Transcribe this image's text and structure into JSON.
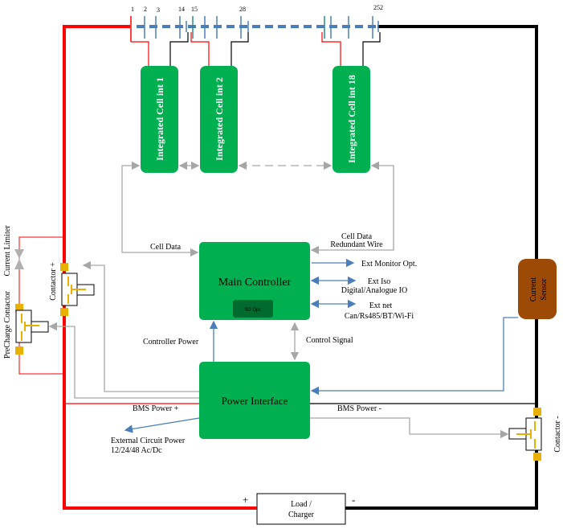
{
  "cells": {
    "numbers": [
      "1",
      "2",
      "3",
      "14",
      "15",
      "28",
      "252"
    ]
  },
  "modules": [
    {
      "label": "Integrated Cell int 1"
    },
    {
      "label": "Integrated Cell int 2"
    },
    {
      "label": "Integrated Cell int 18"
    }
  ],
  "main_controller": {
    "label": "Main Controller",
    "sd": "SD Opt."
  },
  "power_interface": {
    "label": "Power Interface"
  },
  "current_sensor": {
    "line1": "Current",
    "line2": "Sensor"
  },
  "labels": {
    "cell_data": "Cell Data",
    "cell_data_redundant_1": "Cell Data",
    "cell_data_redundant_2": "Redundant Wire",
    "ext_monitor": "Ext Monitor Opt.",
    "ext_iso_1": "Ext Iso",
    "ext_iso_2": "Digital/Analogue IO",
    "ext_net_1": "Ext net",
    "ext_net_2": "Can/Rs485/BT/Wi-Fi",
    "controller_power": "Controller Power",
    "control_signal": "Control Signal",
    "bms_power_plus": "BMS Power +",
    "bms_power_minus": "BMS Power -",
    "ext_circuit_1": "External Circuit Power",
    "ext_circuit_2": "12/24/48 Ac/Dc",
    "current_limiter": "Current Limiter",
    "precharge": "PreCharge Contactor",
    "contactor_plus": "Contactor +",
    "contactor_minus": "Contactor -",
    "load_1": "Load /",
    "load_2": "Charger",
    "plus": "+",
    "minus": "-"
  },
  "colors": {
    "green": "#00b050",
    "dark_green": "#006b2e",
    "brown": "#9c4a06",
    "red": "#ff0000",
    "blue": "#4a7ebb",
    "gray": "#a6a6a6",
    "orange": "#e8b000"
  }
}
